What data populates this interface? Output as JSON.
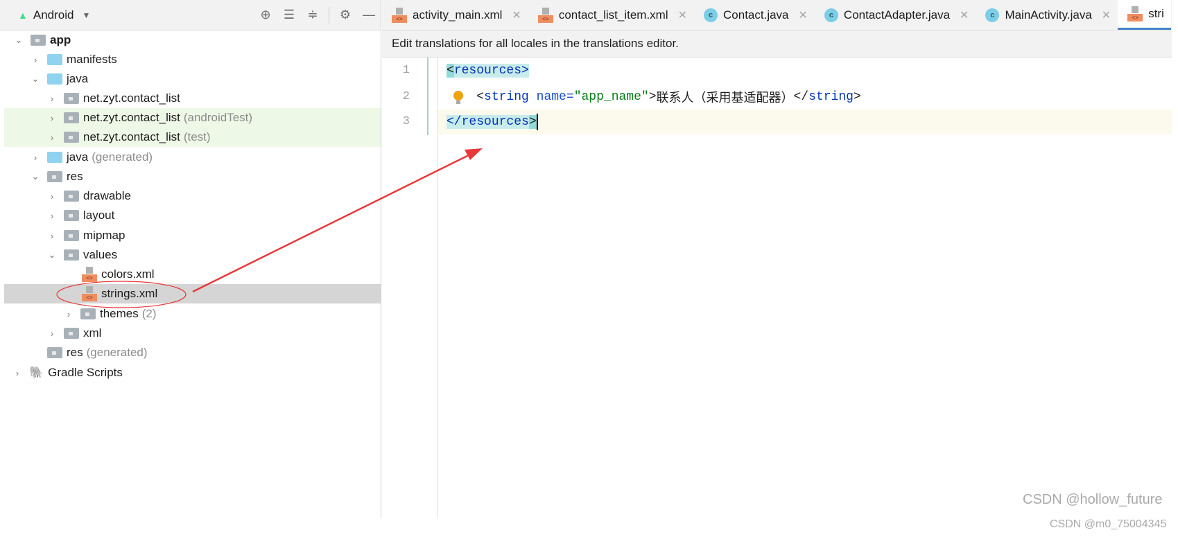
{
  "project_panel": {
    "view_label": "Android",
    "tree": [
      {
        "label": "app",
        "suffix": "",
        "expanded": true
      },
      {
        "label": "manifests",
        "suffix": ""
      },
      {
        "label": "java",
        "suffix": "",
        "expanded": true
      },
      {
        "label": "net.zyt.contact_list",
        "suffix": ""
      },
      {
        "label": "net.zyt.contact_list",
        "suffix": "(androidTest)"
      },
      {
        "label": "net.zyt.contact_list",
        "suffix": "(test)"
      },
      {
        "label": "java",
        "suffix": "(generated)"
      },
      {
        "label": "res",
        "suffix": "",
        "expanded": true
      },
      {
        "label": "drawable",
        "suffix": ""
      },
      {
        "label": "layout",
        "suffix": ""
      },
      {
        "label": "mipmap",
        "suffix": ""
      },
      {
        "label": "values",
        "suffix": "",
        "expanded": true
      },
      {
        "label": "colors.xml",
        "suffix": ""
      },
      {
        "label": "strings.xml",
        "suffix": "",
        "selected": true
      },
      {
        "label": "themes",
        "suffix": "(2)"
      },
      {
        "label": "xml",
        "suffix": ""
      },
      {
        "label": "res",
        "suffix": "(generated)"
      },
      {
        "label": "Gradle Scripts",
        "suffix": ""
      }
    ]
  },
  "tabs": [
    {
      "label": "activity_main.xml",
      "icon": "xml-file-icon"
    },
    {
      "label": "contact_list_item.xml",
      "icon": "xml-file-icon"
    },
    {
      "label": "Contact.java",
      "icon": "class-icon"
    },
    {
      "label": "ContactAdapter.java",
      "icon": "class-icon"
    },
    {
      "label": "MainActivity.java",
      "icon": "class-icon"
    },
    {
      "label": "stri",
      "icon": "xml-file-icon",
      "active": true
    }
  ],
  "info_bar": "Edit translations for all locales in the translations editor.",
  "editor": {
    "line_numbers": [
      "1",
      "2",
      "3"
    ],
    "line1": {
      "open": "<",
      "tag": "resources",
      "close": ">"
    },
    "line2": {
      "indent": "    ",
      "open": "<",
      "tag": "string",
      "sp": " ",
      "attr": "name",
      "eq": "=",
      "value": "\"app_name\"",
      "gt": ">",
      "text": "联系人（采用基适配器）",
      "end_open": "</",
      "end_tag": "string",
      "end_close": ">"
    },
    "line3": {
      "open": "</",
      "tag": "resources",
      "close": ">"
    }
  },
  "watermarks": [
    "CSDN @hollow_future",
    "CSDN @m0_75004345"
  ],
  "annotation_color": "#e8383a"
}
